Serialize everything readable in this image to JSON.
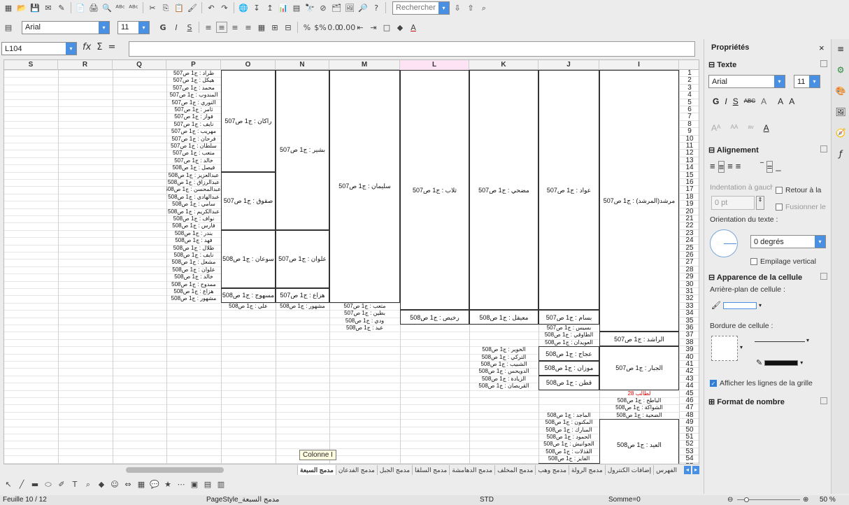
{
  "toolbar1": {
    "icons": [
      "new-icon",
      "open-icon",
      "save-icon",
      "email-icon",
      "edit-file-icon",
      "export-pdf-icon",
      "print-icon",
      "page-preview-icon",
      "spelling-icon",
      "autospell-icon",
      "cut-icon",
      "copy-icon",
      "paste-icon",
      "clone-format-icon",
      "undo-icon",
      "redo-icon",
      "hyperlink-icon",
      "sort-ascending-icon",
      "sort-descending-icon",
      "chart-icon",
      "pivot-icon",
      "find-replace-icon",
      "navigator-icon",
      "gallery-icon",
      "image-icon",
      "zoom-icon",
      "help-icon"
    ],
    "search_value": "Rechercher",
    "glyphs": [
      "▦",
      "📂",
      "💾",
      "✉",
      "✎",
      "📄",
      "🖨",
      "🔍",
      "ᴬᴮᶜ",
      "ᴬᴮᶜ",
      "✂",
      "⎘",
      "📋",
      "🖌",
      "↶",
      "↷",
      "🌐",
      "↧",
      "↥",
      "📊",
      "▤",
      "🔭",
      "⊘",
      "🗂",
      "🖼",
      "🔎",
      "?"
    ]
  },
  "toolbar2": {
    "font_name": "Arial",
    "font_size": "11",
    "bold": "G",
    "italic": "I",
    "underline": "S",
    "glyphs": [
      "≡",
      "≡",
      "≡",
      "≡",
      "▦",
      "⊞",
      "⊟",
      "%",
      "$%",
      "0.0",
      "0.00",
      "⇤",
      "⇥",
      "□",
      "◆",
      "A"
    ]
  },
  "formula_bar": {
    "name_box": "L104",
    "fx": "fx",
    "sigma": "Σ",
    "equals": "=",
    "content": ""
  },
  "grid": {
    "columns": [
      "S",
      "R",
      "Q",
      "P",
      "O",
      "N",
      "M",
      "L",
      "K",
      "J",
      "I"
    ],
    "selected_column": "L",
    "row_numbers": [
      "1",
      "2",
      "3",
      "4",
      "5",
      "6",
      "7",
      "8",
      "9",
      "10",
      "11",
      "12",
      "13",
      "14",
      "15",
      "16",
      "17",
      "18",
      "19",
      "20",
      "21",
      "22",
      "23",
      "24",
      "25",
      "26",
      "27",
      "28",
      "29",
      "30",
      "31",
      "32",
      "33",
      "34",
      "35",
      "36",
      "37",
      "38",
      "39",
      "40",
      "41",
      "42",
      "43",
      "44",
      "45",
      "46",
      "47",
      "48",
      "49",
      "50",
      "51",
      "52",
      "53",
      "54",
      "55",
      "56"
    ],
    "cells_P": [
      "طراد : ج1 ص507",
      "هيكل : ج1 ص507",
      "محمد : ج1 ص507",
      "المندوب : ج1 ص507",
      "النوري : ج1 ص507",
      "ثامر : ج1 ص507",
      "فواز : ج1 ص507",
      "نايف : ج1 ص507",
      "مهريب : ج1 ص507",
      "فرحان : ج1 ص507",
      "سلطان : ج1 ص507",
      "متعب : ج1 ص507",
      "خالد : ج1 ص507",
      "فيصل : ج1 ص508",
      "عبدالعزيز : ج1 ص508",
      "عبدالرزاق : ج1 ص508",
      "عبدالمحسن : ج1 ص508",
      "عبدالهادي : ج1 ص508",
      "سامي : ج1 ص508",
      "عبدالكريم : ج1 ص508",
      "نواف : ج1 ص508",
      "فارس : ج1 ص508",
      "بندر : ج1 ص508",
      "فهد : ج1 ص508",
      "طلال : ج1 ص508",
      "نايف : ج1 ص508",
      "مشعل : ج1 ص508",
      "علوان : ج1 ص508",
      "خالد : ج1 ص508",
      "ممدوح : ج1 ص508",
      "هزاع : ج1 ص508",
      "مشهور : ج1 ص508"
    ],
    "cell_O_1": "راكان : ج1 ص507",
    "cell_O_2": "صقوق : ج1 ص507",
    "cell_O_3": "سوعان : ج1 ص508",
    "cell_O_4": "مسهوج : ج1 ص508",
    "cell_O_5": "علي : ج1 ص508",
    "cell_N_1": "بشير : ج1 ص507",
    "cell_N_2": "علوان : ج1 ص507",
    "cell_N_3": "هزاع : ج1 ص507",
    "cell_N_4": "مشهور : ج1 ص508",
    "cell_M_1": "سليمان : ج1 ص507",
    "cells_M_list": [
      "متعب : ج1 ص507",
      "بطين : ج1 ص507",
      "ودي : ج1 ص508",
      "عيد : ج1 ص508"
    ],
    "cell_L_1": "ثلاب : ج1 ص507",
    "cell_L_2": "رخيص : ج1 ص508",
    "cell_K_1": "مضحي : ج1 ص507",
    "cell_K_2": "معيقل : ج1 ص508",
    "cells_K_list1": [
      "الخوير : ج1 ص508",
      "التركي : ج1 ص508",
      "الشبيب : ج1 ص508",
      "الدويحس : ج1 ص508",
      "الزيادة : ج1 ص508",
      "القريصان : ج1 ص508"
    ],
    "cells_K_list2": [
      "الضبعة : ج1 ص508",
      "الهبيلة : ج1 ص508"
    ],
    "cell_J_1": "عواد : ج1 ص507",
    "cell_J_2": "بسام : ج1 ص507",
    "cells_J_list1": [
      "بسيس : ج1 ص507",
      "الطاوقي : ج1 ص508",
      "العويدان : ج1 ص508"
    ],
    "cell_J_3": "عجاج : ج1 ص508",
    "cell_J_4": "موزان : ج1 ص508",
    "cell_J_5": "قطن : ج1 ص508",
    "cells_J_list2": [
      "الماجد : ج1 ص508",
      "المكنون : ج1 ص508",
      "المبارك : ج1 ص508",
      "الحمود : ج1 ص508",
      "الجوانيش : ج1 ص508",
      "القذلات : ج1 ص508",
      "الفايز : ج1 ص508"
    ],
    "cell_J_6": "السويلم : ج1 ص508",
    "cell_I_1": "مرشد(المرشد) : ج1 ص507",
    "cell_I_2": "الراشد : ج1 ص507",
    "cell_I_3": "الجبار : ج1 ص507",
    "cell_I_red": "لطالب 28",
    "cells_I_list": [
      "الباطح : ج1 ص508",
      "الشواكة : ج1 ص508",
      "الضحية : ج1 ص508"
    ],
    "cell_I_4": "العيد : ج1 ص508"
  },
  "tabs": {
    "nav": [
      "◂",
      "▸"
    ],
    "items": [
      "الفهرس",
      "إضافات الكنترول",
      "مدمج الرولة",
      "مدمج وهب",
      "مدمج المخلف",
      "مدمج الدهامشة",
      "مدمج السلقا",
      "مدمج الجبل",
      "مدمج الفدعان",
      "مدمج السبعة"
    ],
    "active_index": 9
  },
  "tooltip": "Colonne I",
  "drawbar": {
    "glyphs": [
      "↖",
      "╱",
      "▬",
      "⬭",
      "✐",
      "T",
      "⌕",
      "◆",
      "☺",
      "⇔",
      "▦",
      "💬",
      "★",
      "⋯",
      "▣",
      "▤",
      "▥"
    ]
  },
  "status": {
    "sheet": "Feuille 10 / 12",
    "page_style": "PageStyle_مدمج السبعة",
    "mode": "STD",
    "sum": "Somme=0",
    "zoom": "50 %",
    "zoom_level": 0.5
  },
  "sidebar": {
    "title": "Propriétés",
    "close": "×",
    "texte": {
      "header": "Texte",
      "font_name": "Arial",
      "font_size": "11",
      "bold": "G",
      "italic": "I",
      "underline": "S",
      "strike": "ABC",
      "shadow": "A",
      "grow": "A",
      "shrink": "A",
      "font_color": "A"
    },
    "alignement": {
      "header": "Alignement",
      "indent_label": "Indentation à gauche",
      "indent_value": "0 pt",
      "wrap_label": "Retour à la",
      "merge_label": "Fusionner le",
      "orientation_label": "Orientation du texte :",
      "degrees": "0 degrés",
      "vertical_stack": "Empilage vertical"
    },
    "apparence": {
      "header": "Apparence de la cellule",
      "bg_label": "Arrière-plan de cellule :",
      "border_label": "Bordure de cellule :",
      "gridlines_label": "Afficher les lignes de la grille"
    },
    "format": {
      "header": "Format de nombre"
    }
  },
  "decks": {
    "glyphs": [
      "⚙",
      "🎨",
      "🧭",
      "ƒ"
    ]
  },
  "colors": {
    "accent": "#4a90e2",
    "selected_column": "#fde3f3",
    "red_text": "#dd0000"
  }
}
